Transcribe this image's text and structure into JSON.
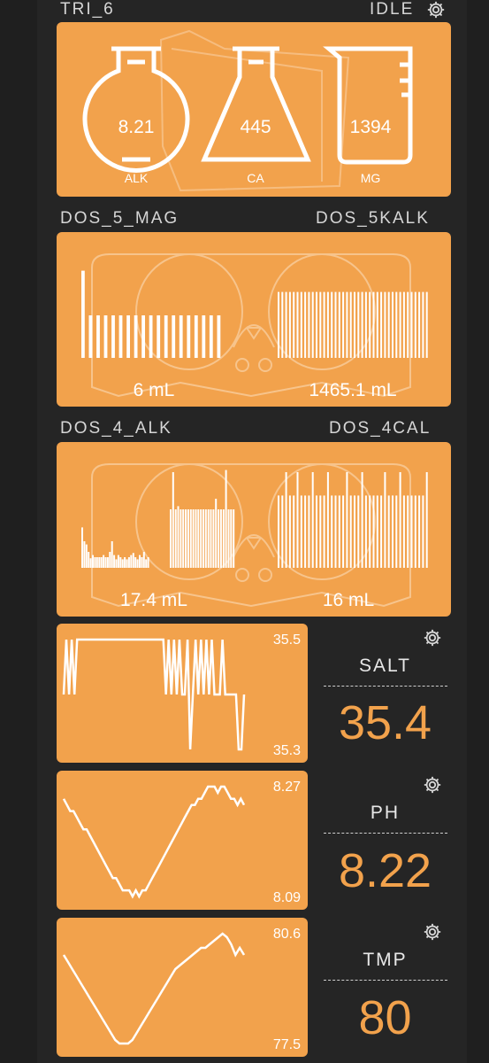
{
  "header1": {
    "left": "TRI_6",
    "right": "IDLE"
  },
  "tri": {
    "alk": {
      "value": "8.21",
      "label": "ALK"
    },
    "ca": {
      "value": "445",
      "label": "CA"
    },
    "mg": {
      "value": "1394",
      "label": "MG"
    }
  },
  "header2": {
    "left": "DOS_5_MAG",
    "right": "DOS_5KALK"
  },
  "dos5": {
    "left_value": "6 mL",
    "right_value": "1465.1 mL",
    "left_bars": [
      0.82,
      0.4,
      0.4,
      0.4,
      0.4,
      0.4,
      0.4,
      0.4,
      0.4,
      0.4,
      0.4,
      0.4,
      0.4,
      0.4,
      0.4,
      0.4,
      0.4,
      0.4,
      0.4
    ],
    "right_bars": [
      0.62,
      0.62,
      0.62,
      0.62,
      0.62,
      0.62,
      0.62,
      0.62,
      0.62,
      0.62,
      0.62,
      0.62,
      0.62,
      0.62,
      0.62,
      0.62,
      0.62,
      0.62,
      0.62,
      0.62,
      0.62,
      0.62,
      0.62,
      0.62,
      0.62,
      0.62,
      0.62,
      0.62,
      0.62,
      0.62,
      0.62,
      0.62,
      0.62,
      0.62,
      0.62,
      0.62,
      0.62,
      0.62,
      0.62,
      0.62
    ]
  },
  "header3": {
    "left": "DOS_4_ALK",
    "right": "DOS_4CAL"
  },
  "dos4": {
    "left_value": "17.4 mL",
    "right_value": "16 mL",
    "left_bars": [
      0.38,
      0.25,
      0.22,
      0.15,
      0.09,
      0.12,
      0.1,
      0.1,
      0.1,
      0.1,
      0.12,
      0.1,
      0.1,
      0.15,
      0.25,
      0.12,
      0.08,
      0.12,
      0.1,
      0.08,
      0.1,
      0.08,
      0.1,
      0.12,
      0.14,
      0.1,
      0.08,
      0.12,
      0.1,
      0.15,
      0.08,
      0.1
    ],
    "left_big_bars": [
      0.55,
      0.9,
      0.55,
      0.58,
      0.55,
      0.55,
      0.55,
      0.55,
      0.55,
      0.55,
      0.55,
      0.55,
      0.55,
      0.55,
      0.55,
      0.55,
      0.55,
      0.55,
      0.65,
      0.55,
      0.55,
      0.55,
      0.92,
      0.55,
      0.55,
      0.55
    ],
    "right_bars": [
      0.68,
      0.68,
      0.9,
      0.68,
      0.68,
      0.9,
      0.68,
      0.68,
      0.68,
      0.9,
      0.68,
      0.68,
      0.68,
      0.9,
      0.68,
      0.68,
      0.68,
      0.68,
      0.9,
      0.68,
      0.68,
      0.68,
      0.9,
      0.68,
      0.68,
      0.68,
      0.68,
      0.68,
      0.9,
      0.68,
      0.68,
      0.68,
      0.9,
      0.68,
      0.68,
      0.68,
      0.68,
      0.68,
      0.68,
      0.9
    ]
  },
  "salt": {
    "title": "SALT",
    "value": "35.4",
    "ymax": "35.5",
    "ymin": "35.3",
    "range": [
      35.3,
      35.5
    ],
    "series": [
      35.4,
      35.5,
      35.4,
      35.5,
      35.4,
      35.5,
      35.5,
      35.5,
      35.5,
      35.5,
      35.5,
      35.5,
      35.5,
      35.5,
      35.5,
      35.5,
      35.5,
      35.5,
      35.5,
      35.5,
      35.5,
      35.5,
      35.5,
      35.5,
      35.5,
      35.5,
      35.5,
      35.5,
      35.5,
      35.5,
      35.5,
      35.5,
      35.5,
      35.5,
      35.5,
      35.5,
      35.5,
      35.5,
      35.4,
      35.5,
      35.4,
      35.5,
      35.4,
      35.5,
      35.4,
      35.4,
      35.5,
      35.3,
      35.4,
      35.5,
      35.4,
      35.5,
      35.4,
      35.5,
      35.4,
      35.5,
      35.4,
      35.4,
      35.4,
      35.5,
      35.4,
      35.4,
      35.4,
      35.4,
      35.4,
      35.3,
      35.3,
      35.4
    ]
  },
  "ph": {
    "title": "PH",
    "value": "8.22",
    "ymax": "8.27",
    "ymin": "8.09",
    "range": [
      8.09,
      8.27
    ],
    "series": [
      8.25,
      8.24,
      8.23,
      8.23,
      8.22,
      8.21,
      8.2,
      8.2,
      8.19,
      8.18,
      8.17,
      8.16,
      8.15,
      8.14,
      8.13,
      8.12,
      8.12,
      8.11,
      8.1,
      8.1,
      8.1,
      8.09,
      8.1,
      8.09,
      8.1,
      8.1,
      8.11,
      8.12,
      8.13,
      8.14,
      8.15,
      8.16,
      8.17,
      8.18,
      8.19,
      8.2,
      8.21,
      8.22,
      8.23,
      8.24,
      8.24,
      8.25,
      8.25,
      8.26,
      8.27,
      8.27,
      8.27,
      8.26,
      8.27,
      8.27,
      8.26,
      8.25,
      8.25,
      8.24,
      8.25,
      8.24
    ]
  },
  "tmp": {
    "title": "TMP",
    "value": "80",
    "ymax": "80.6",
    "ymin": "77.5",
    "range": [
      77.5,
      80.6
    ],
    "series": [
      80.0,
      79.8,
      79.6,
      79.4,
      79.2,
      79.0,
      78.8,
      78.6,
      78.4,
      78.2,
      78.0,
      77.8,
      77.6,
      77.5,
      77.5,
      77.5,
      77.6,
      77.8,
      78.0,
      78.2,
      78.4,
      78.6,
      78.8,
      79.0,
      79.2,
      79.4,
      79.6,
      79.7,
      79.8,
      79.9,
      80.0,
      80.1,
      80.2,
      80.2,
      80.3,
      80.4,
      80.5,
      80.6,
      80.5,
      80.3,
      80.0,
      80.2,
      80.0
    ]
  },
  "colors": {
    "accent": "#f2a24c",
    "background": "#252525",
    "text": "#ffffff",
    "muted": "#d6d6d6"
  }
}
